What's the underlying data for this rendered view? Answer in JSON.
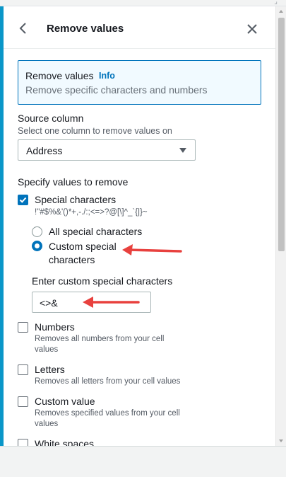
{
  "panel": {
    "title": "Remove values",
    "back_icon": "chevron-left-icon",
    "close_icon": "close-icon"
  },
  "infobox": {
    "title": "Remove values",
    "info_link": "Info",
    "description": "Remove specific characters and numbers"
  },
  "source_column": {
    "label": "Source column",
    "description": "Select one column to remove values on",
    "selected": "Address"
  },
  "values_section": {
    "label": "Specify values to remove",
    "special_characters": {
      "label": "Special characters",
      "checked": true,
      "description": "!\"#$%&'()*+,-./:;<=>?@[\\]^_`{|}~",
      "options": [
        {
          "label": "All special characters",
          "selected": false
        },
        {
          "label_line1": "Custom special",
          "label_line2": "characters",
          "selected": true
        }
      ],
      "custom_label": "Enter custom special characters",
      "custom_value": "<>&"
    },
    "numbers": {
      "label": "Numbers",
      "checked": false,
      "description_line1": "Removes all numbers from your cell",
      "description_line2": "values"
    },
    "letters": {
      "label": "Letters",
      "checked": false,
      "description": "Removes all letters from your cell values"
    },
    "custom_value": {
      "label": "Custom value",
      "checked": false,
      "description_line1": "Removes specified values from your cell",
      "description_line2": "values"
    },
    "white_spaces": {
      "label": "White spaces",
      "checked": false
    }
  },
  "annotation_color": "#e8413e",
  "accent_color": "#0073bb"
}
